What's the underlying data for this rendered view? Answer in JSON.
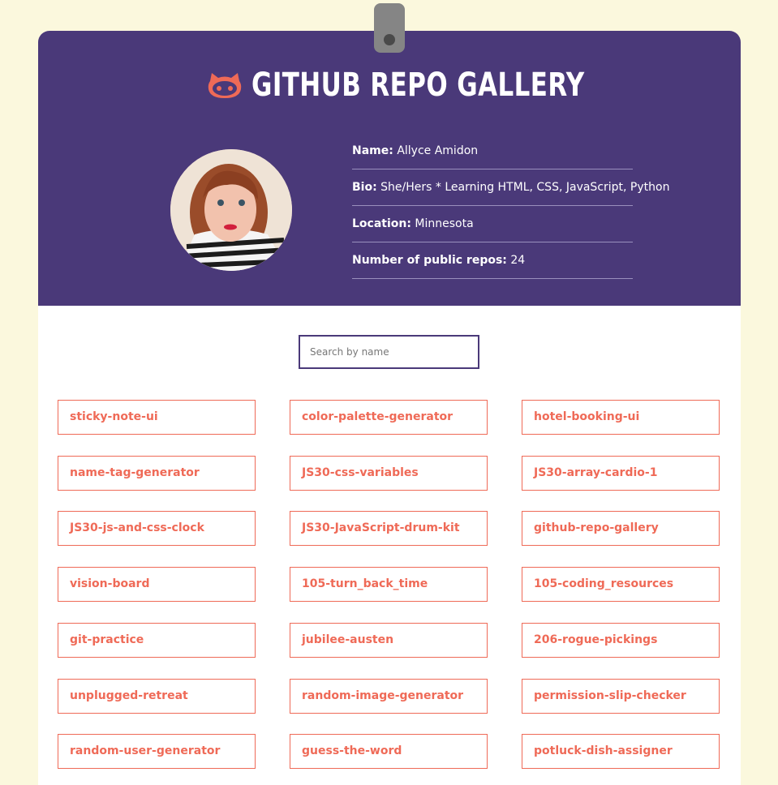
{
  "header": {
    "title": "GITHUB REPO GALLERY",
    "icon": "github-octocat-icon",
    "background_color": "#4a3979",
    "accent_color": "#ef6a57"
  },
  "profile": {
    "avatar": "profile-photo",
    "name_label": "Name:",
    "name_value": "Allyce Amidon",
    "bio_label": "Bio:",
    "bio_value": "She/Hers * Learning HTML, CSS, JavaScript, Python",
    "location_label": "Location:",
    "location_value": "Minnesota",
    "repos_label": "Number of public repos:",
    "repos_value": "24"
  },
  "search": {
    "placeholder": "Search by name",
    "value": ""
  },
  "repos": [
    "sticky-note-ui",
    "color-palette-generator",
    "hotel-booking-ui",
    "name-tag-generator",
    "JS30-css-variables",
    "JS30-array-cardio-1",
    "JS30-js-and-css-clock",
    "JS30-JavaScript-drum-kit",
    "github-repo-gallery",
    "vision-board",
    "105-turn_back_time",
    "105-coding_resources",
    "git-practice",
    "jubilee-austen",
    "206-rogue-pickings",
    "unplugged-retreat",
    "random-image-generator",
    "permission-slip-checker",
    "random-user-generator",
    "guess-the-word",
    "potluck-dish-assigner"
  ]
}
